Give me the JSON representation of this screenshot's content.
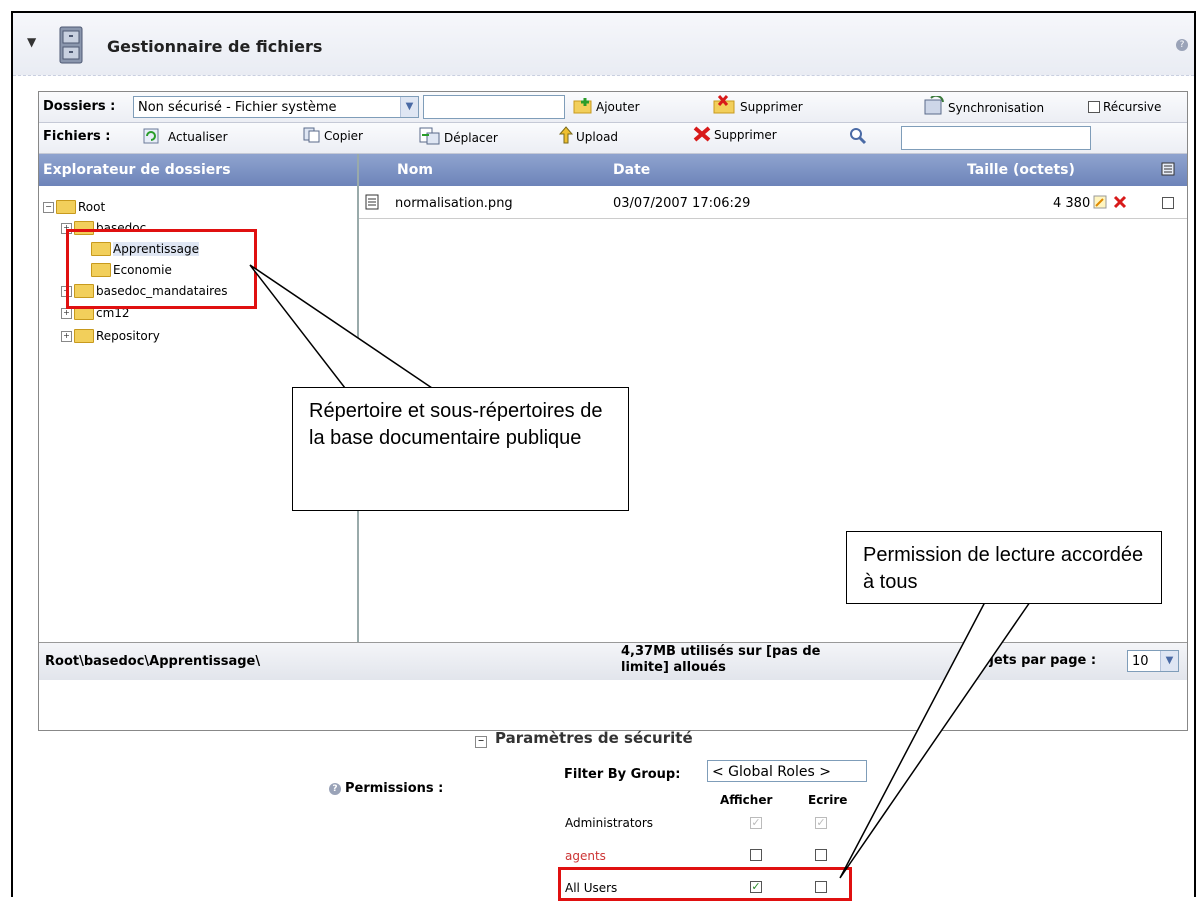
{
  "window": {
    "title": "Gestionnaire de fichiers"
  },
  "toolbar1": {
    "label": "Dossiers :",
    "folder_select": "Non sécurisé - Fichier système",
    "add": "Ajouter",
    "delete": "Supprimer",
    "sync": "Synchronisation",
    "recursive": "Récursive"
  },
  "toolbar2": {
    "label": "Fichiers :",
    "refresh": "Actualiser",
    "copy": "Copier",
    "move": "Déplacer",
    "upload": "Upload",
    "delete": "Supprimer"
  },
  "explorer": {
    "title": "Explorateur de dossiers",
    "items": [
      "Root",
      "basedoc",
      "Apprentissage",
      "Economie",
      "basedoc_mandataires",
      "cm12",
      "Repository"
    ]
  },
  "files": {
    "headers": {
      "name": "Nom",
      "date": "Date",
      "size": "Taille (octets)"
    },
    "rows": [
      {
        "name": "normalisation.png",
        "date": "03/07/2007 17:06:29",
        "size": "4 380"
      }
    ]
  },
  "footer": {
    "path": "Root\\basedoc\\Apprentissage\\",
    "usage": "4,37MB utilisés sur [pas de limite] alloués",
    "per_page_label": "Objets par page :",
    "per_page": "10"
  },
  "security": {
    "title": "Paramètres de sécurité",
    "permissions_label": "Permissions :",
    "filter_label": "Filter By Group:",
    "filter_value": "< Global Roles >",
    "col_view": "Afficher",
    "col_write": "Ecrire",
    "roles": [
      {
        "name": "Administrators",
        "view": true,
        "write": true
      },
      {
        "name": "agents",
        "view": false,
        "write": false
      },
      {
        "name": "All Users",
        "view": true,
        "write": false
      }
    ]
  },
  "callouts": {
    "left": "Répertoire et sous-répertoires de la base documentaire publique",
    "right": "Permission de lecture accordée à tous"
  }
}
